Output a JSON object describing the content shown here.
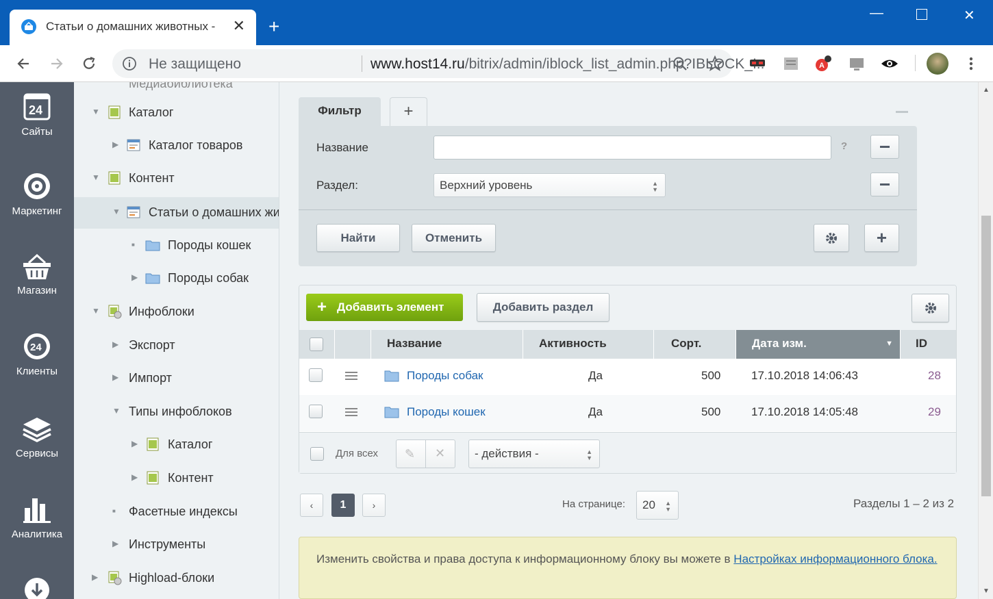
{
  "browser": {
    "tab_title": "Статьи о домашних животных -",
    "security_label": "Не защищено",
    "url_domain": "www.host14.ru",
    "url_path": "/bitrix/admin/iblock_list_admin.php?IBLOCK_I..."
  },
  "left_menu": {
    "items": [
      "Сайты",
      "Маркетинг",
      "Магазин",
      "Клиенты",
      "Сервисы",
      "Аналитика"
    ]
  },
  "tree": {
    "items": [
      {
        "label": "Медиабиблиотека"
      },
      {
        "label": "Каталог"
      },
      {
        "label": "Каталог товаров"
      },
      {
        "label": "Контент"
      },
      {
        "label": "Статьи о домашних животных"
      },
      {
        "label": "Породы кошек"
      },
      {
        "label": "Породы собак"
      },
      {
        "label": "Инфоблоки"
      },
      {
        "label": "Экспорт"
      },
      {
        "label": "Импорт"
      },
      {
        "label": "Типы инфоблоков"
      },
      {
        "label": "Каталог"
      },
      {
        "label": "Контент"
      },
      {
        "label": "Фасетные индексы"
      },
      {
        "label": "Инструменты"
      },
      {
        "label": "Highload-блоки"
      }
    ]
  },
  "filter": {
    "tab_label": "Фильтр",
    "name_label": "Название",
    "name_value": "",
    "section_label": "Раздел:",
    "section_value": "Верхний уровень",
    "help": "?",
    "find_button": "Найти",
    "cancel_button": "Отменить"
  },
  "list": {
    "add_element": "Добавить элемент",
    "add_section": "Добавить раздел",
    "columns": {
      "name": "Название",
      "active": "Активность",
      "sort": "Сорт.",
      "date": "Дата изм.",
      "id": "ID"
    },
    "rows": [
      {
        "name": "Породы собак",
        "active": "Да",
        "sort": "500",
        "date": "17.10.2018 14:06:43",
        "id": "28"
      },
      {
        "name": "Породы кошек",
        "active": "Да",
        "sort": "500",
        "date": "17.10.2018 14:05:48",
        "id": "29"
      }
    ],
    "for_all": "Для всех",
    "actions": "- действия -"
  },
  "pager": {
    "current": "1",
    "per_page_label": "На странице:",
    "per_page": "20",
    "summary": "Разделы 1 – 2 из 2"
  },
  "note": {
    "text": "Изменить свойства и права доступа к информационному блоку вы можете в ",
    "link": "Настройках информационного блока."
  },
  "colors": {
    "chrome_blue": "#0a5eb8",
    "sidebar_dark": "#535c69",
    "accent_green": "#8bbd14",
    "link": "#2067b0"
  }
}
